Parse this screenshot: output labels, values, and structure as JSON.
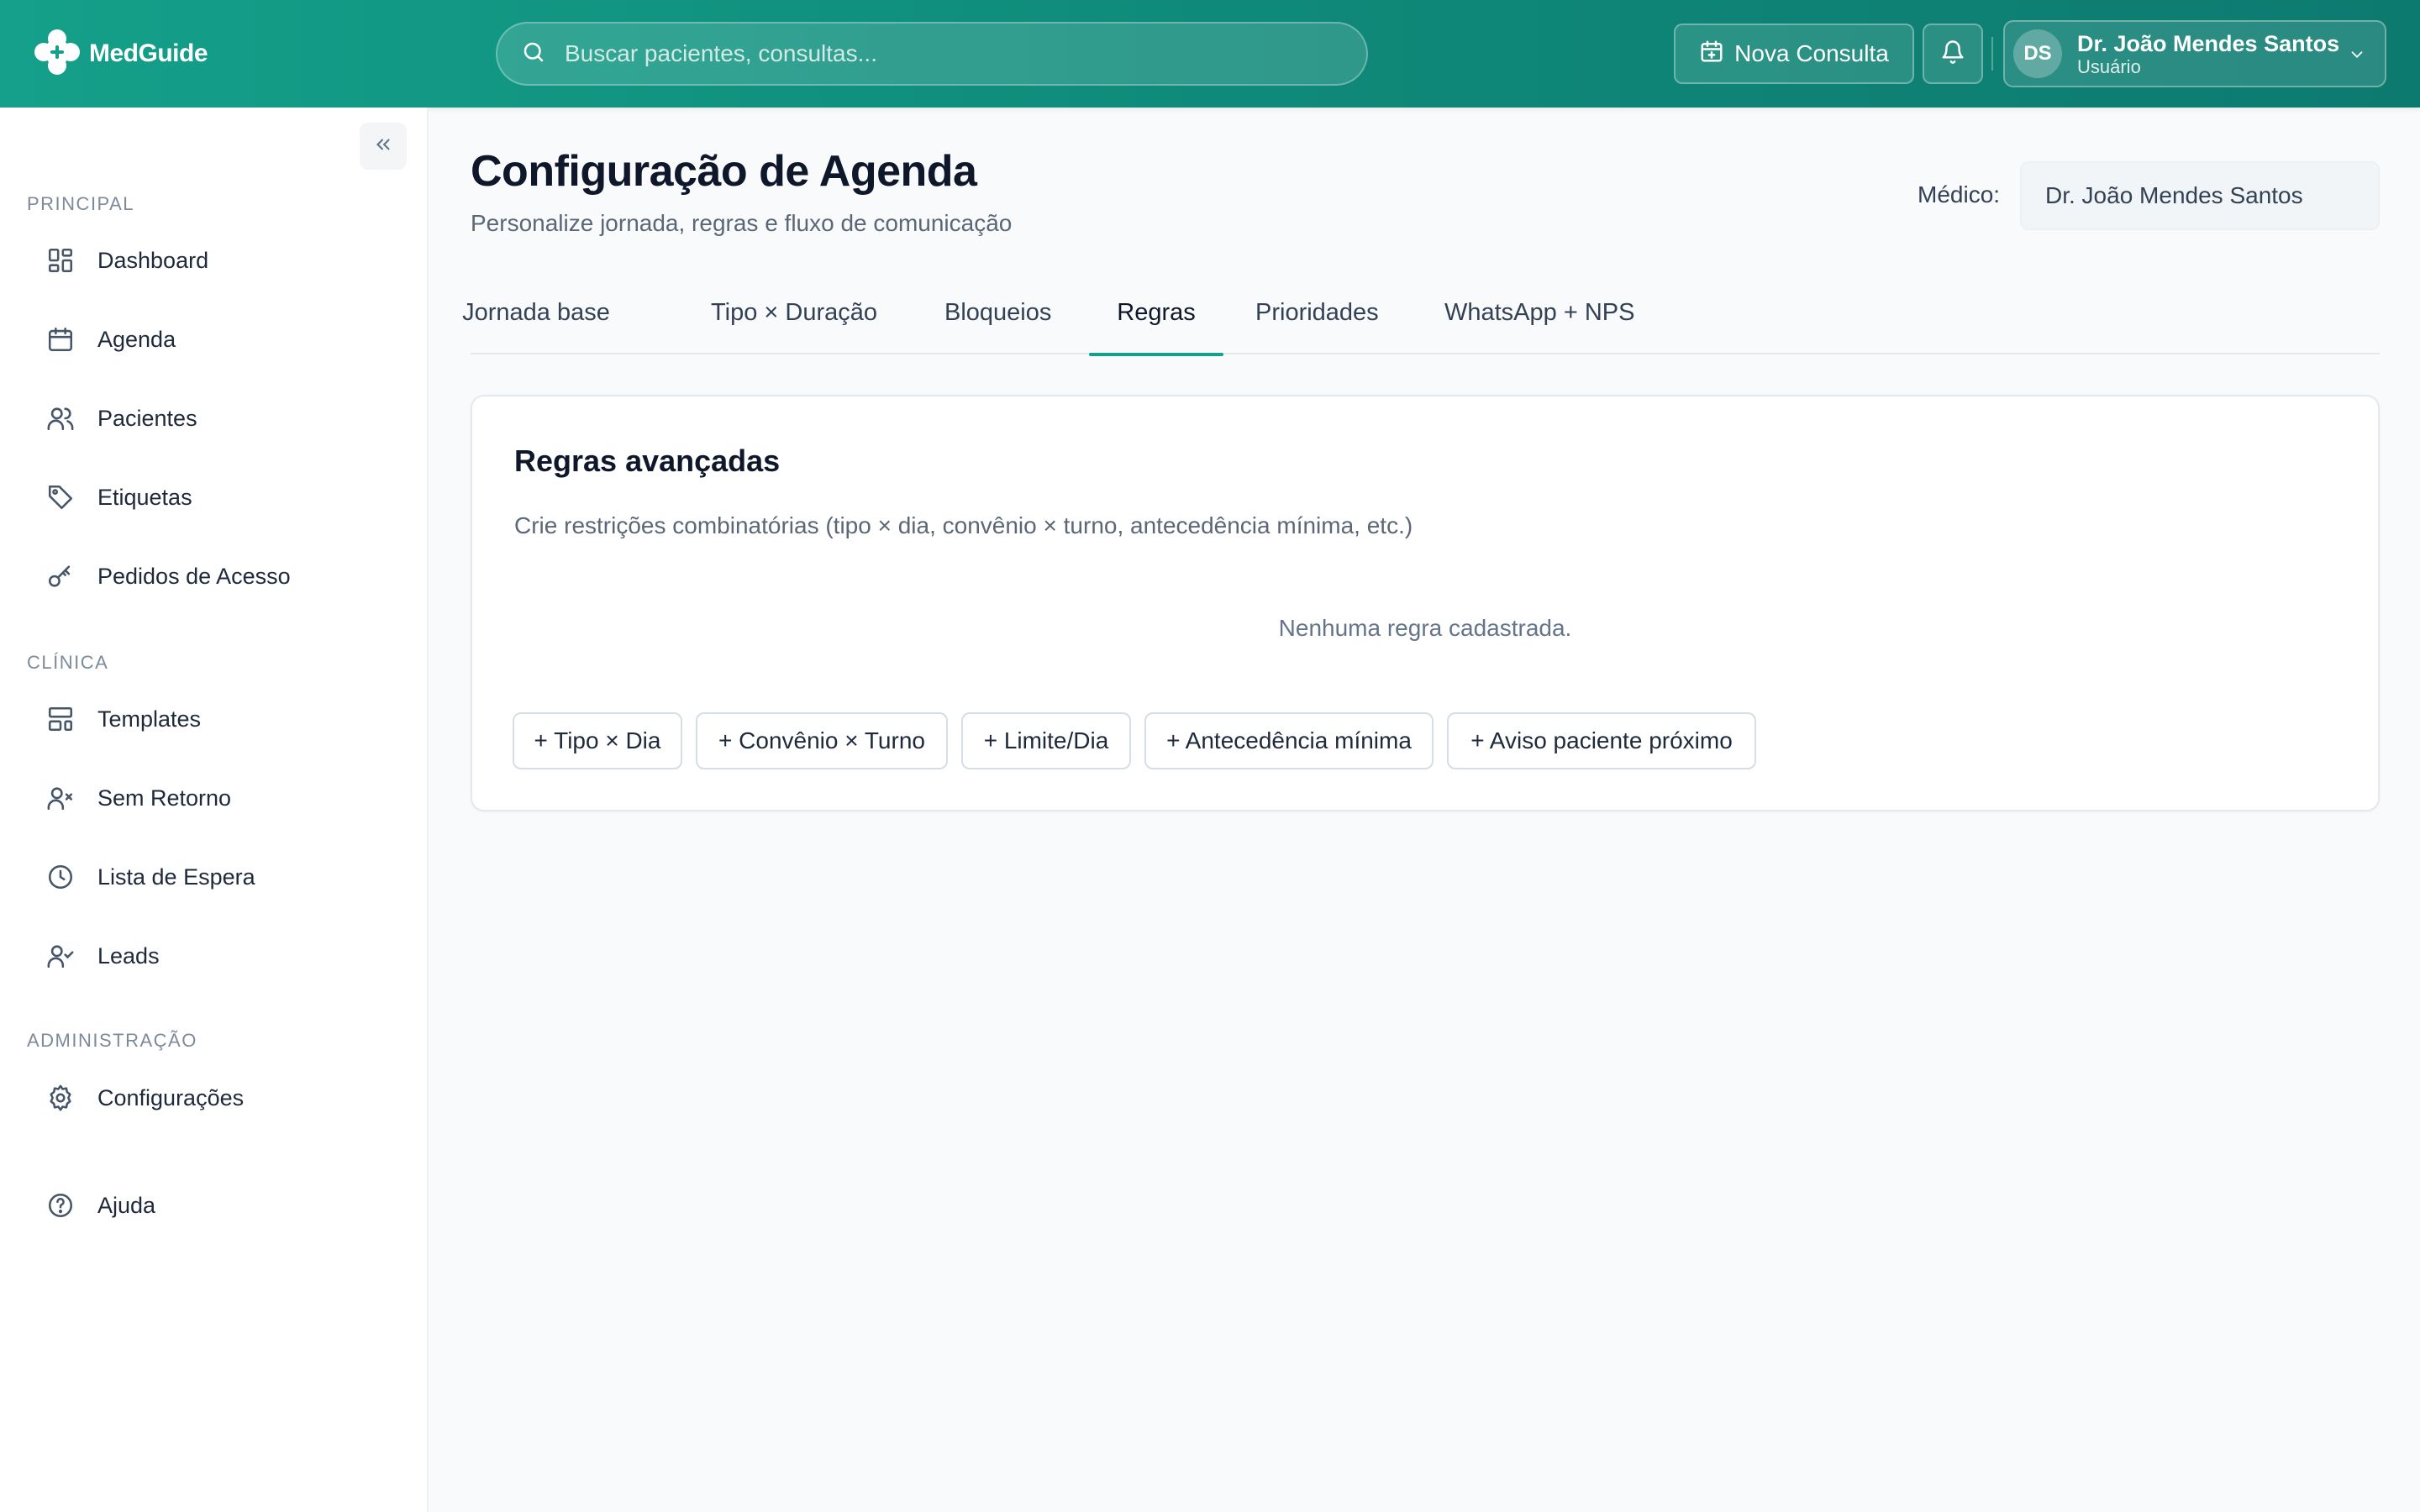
{
  "app": {
    "name": "MedGuide"
  },
  "header": {
    "search_placeholder": "Buscar pacientes, consultas...",
    "new_consult_label": "Nova Consulta",
    "user": {
      "initials": "DS",
      "name": "Dr. João Mendes Santos",
      "role": "Usuário"
    }
  },
  "sidebar": {
    "sections": {
      "principal": "PRINCIPAL",
      "clinica": "CLÍNICA",
      "admin": "ADMINISTRAÇÃO"
    },
    "items": {
      "dashboard": "Dashboard",
      "agenda": "Agenda",
      "pacientes": "Pacientes",
      "etiquetas": "Etiquetas",
      "pedidos": "Pedidos de Acesso",
      "templates": "Templates",
      "sem_retorno": "Sem Retorno",
      "lista_espera": "Lista de Espera",
      "leads": "Leads",
      "configuracoes": "Configurações",
      "ajuda": "Ajuda"
    }
  },
  "page": {
    "title": "Configuração de Agenda",
    "subtitle": "Personalize jornada, regras e fluxo de comunicação",
    "medico_label": "Médico:",
    "medico_value": "Dr. João Mendes Santos"
  },
  "tabs": {
    "jornada": "Jornada base",
    "tipo_duracao": "Tipo × Duração",
    "bloqueios": "Bloqueios",
    "regras": "Regras",
    "prioridades": "Prioridades",
    "whatsapp": "WhatsApp + NPS",
    "active": "regras"
  },
  "card": {
    "title": "Regras avançadas",
    "description": "Crie restrições combinatórias (tipo × dia, convênio × turno, antecedência mínima, etc.)",
    "empty": "Nenhuma regra cadastrada.",
    "buttons": {
      "tipo_dia": "+ Tipo × Dia",
      "convenio_turno": "+ Convênio × Turno",
      "limite_dia": "+ Limite/Dia",
      "antecedencia": "+ Antecedência mínima",
      "aviso": "+ Aviso paciente próximo"
    }
  },
  "colors": {
    "brand": "#14a08a",
    "brand_dark": "#0d7a70",
    "text": "#0f172a",
    "muted": "#5b6777"
  }
}
